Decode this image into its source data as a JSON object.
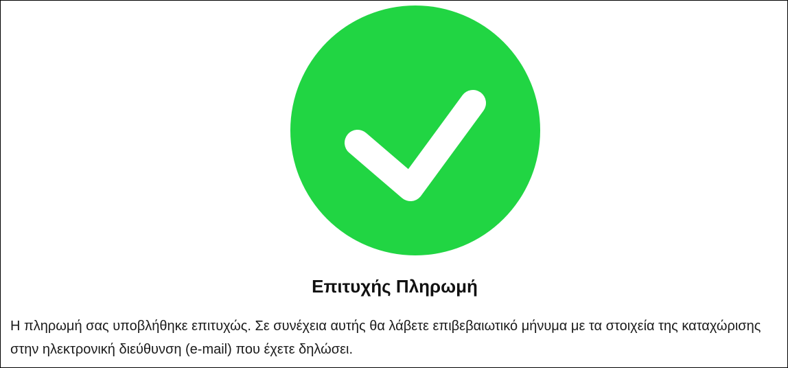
{
  "result": {
    "status": "success",
    "icon": "check-circle-icon",
    "icon_color": "#21D543",
    "check_color": "#FFFFFF",
    "title": "Επιτυχής Πληρωμή",
    "message": "Η πληρωμή σας υποβλήθηκε επιτυχώς. Σε συνέχεια αυτής θα λάβετε επιβεβαιωτικό μήνυμα με τα στοιχεία της καταχώρισης στην ηλεκτρονική διεύθυνση (e-mail) που έχετε δηλώσει."
  }
}
